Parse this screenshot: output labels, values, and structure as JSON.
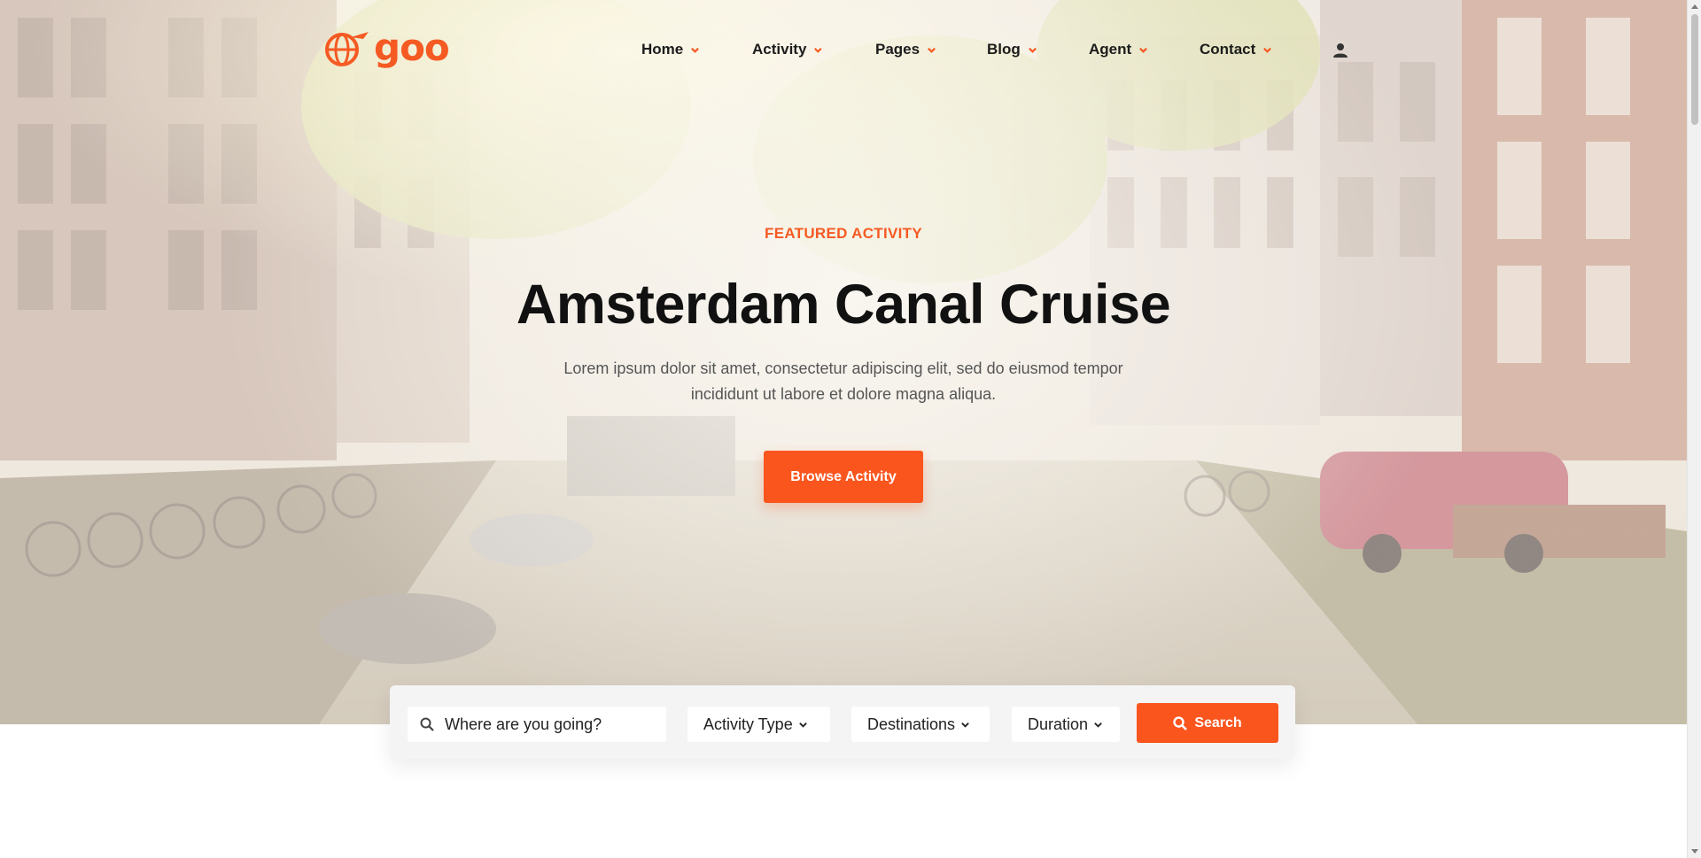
{
  "brand": {
    "name": "goo",
    "accent": "#fb551e"
  },
  "nav": {
    "items": [
      {
        "label": "Home"
      },
      {
        "label": "Activity"
      },
      {
        "label": "Pages"
      },
      {
        "label": "Blog"
      },
      {
        "label": "Agent"
      },
      {
        "label": "Contact"
      }
    ],
    "dropdown_icon": "chevron-down-icon",
    "user_icon": "user-icon"
  },
  "hero": {
    "eyebrow": "FEATURED ACTIVITY",
    "title": "Amsterdam Canal Cruise",
    "description": "Lorem ipsum dolor sit amet, consectetur adipiscing elit, sed do eiusmod tempor incididunt ut labore et dolore magna aliqua.",
    "cta_label": "Browse Activity",
    "background": "amsterdam-canal-photo"
  },
  "search": {
    "placeholder": "Where are you going?",
    "activity_type": "Activity Type",
    "destinations": "Destinations",
    "duration": "Duration",
    "button_label": "Search"
  }
}
